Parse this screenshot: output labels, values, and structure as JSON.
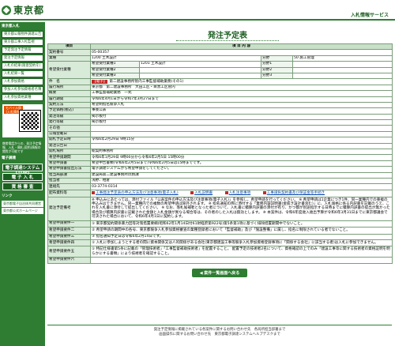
{
  "header": {
    "logo": "東京都",
    "service_title": "入札情報サービス"
  },
  "sidebar": {
    "section1": "東京都入札",
    "items": [
      "東京都公報物件調達公告",
      "東京都工事入札監視",
      "予定発注予定情報",
      "発注予定情報",
      "入札の結果(随意契約を)",
      "入札結果一覧",
      "入札参加資格",
      "参加入札参加資格者名簿",
      "入札参加資格業種"
    ],
    "mobile_label": "モバイル版(入札情報)",
    "mobile_note": "携帯電話からの、発注予定情報、入札・開札(契約)情報の閲覧が可能です",
    "section2": "電子調達",
    "buttons": [
      "電子調達システム(TOP)",
      "電 子 入 札",
      "資 格 審 査"
    ],
    "section3": "リンク",
    "links": [
      "東京都電子自治体共同運営",
      "東京都公式ホームページ"
    ]
  },
  "page": {
    "title": "発注予定表",
    "col_item": "項目",
    "col_content": "項 目 内 容"
  },
  "detail": {
    "contract_no_label": "契約番号",
    "contract_no": "05-00357",
    "industry_label": "業種",
    "industry": "1200 土木設計",
    "class_label": "分野",
    "class": "50 施工管理",
    "desired_label": "希望受付業種",
    "desired_rows": [
      {
        "label": "希望受付業種1",
        "value": "1201 土木設計",
        "sub": "分野1",
        "subval": ""
      },
      {
        "label": "希望受付業種2",
        "value": "",
        "sub": "分野2",
        "subval": ""
      },
      {
        "label": "希望受付業種3",
        "value": "",
        "sub": "分野3",
        "subval": ""
      }
    ],
    "name_label": "件　名",
    "name_tag": "【電子】",
    "name": "第二建設事務所管内工事監督補助業務(その1)",
    "location_label": "履行場所",
    "location": "東京都　第二建設事務所　大田工区・目黒工区管内",
    "summary_label": "概要",
    "summary": "工事監督補助業務　一式",
    "period_label": "履行期間",
    "period": "令和6年4月1日から令和7年3月27日まで",
    "method_label": "契約方法",
    "method": "希望制指名競争入札",
    "estimate_label": "予定価格(税込)",
    "estimate": "事後公表",
    "ordering_label": "発注等級",
    "ordering": "掲示板付",
    "cancel_label": "発行等級",
    "cancel": "掲示板付",
    "other_label": "その他",
    "other": "",
    "release_label": "公報登載日",
    "release": "",
    "open_label": "開札予定日時",
    "open": "令和6年2月29日 9時15分",
    "notice_label": "発注公告日",
    "notice": "",
    "venue_label": "開札場所",
    "venue": "総契約事務所",
    "accept_label": "希望申請期間",
    "accept": "令和6年1月29日 9時00分から令和6年2月5日 15時00分",
    "doc_label": "希望申請書",
    "doc": "希望申告書類(令和6年2月5日まで)令和6年2月5日は15時までです。",
    "docmethod_label": "希望申請書提出方法",
    "docmethod": "電子調達システムから希望申請をしてください。",
    "contact_label": "担当局部課",
    "contact": "建設局第二建設事務所庶務課",
    "person_label": "担当者",
    "person": "浅野、相倉",
    "tel_label": "連絡先",
    "tel": "03-3774-0314",
    "files_label": "配布資料等",
    "files": [
      "工事発注予定表の申込方法及び注意事項(電子入札)",
      "入札説明書",
      "入札注意事項",
      "工事請負契約書及び保証金等手続き"
    ],
    "notes_label": "発注予定備考",
    "notes": "※ 申込みにあたっては、添付ファイル「公表案件の申込方法及び注意事項(電子入札)」を参照し、希望申請を行ってください。\n※ 希望申請は1企業につき1件、同一業種内での重複の申込みはできません。同一業種内での複数の希望申請は除外されます。\n※ 指名通知の際に添付する「業務内容説明書(金抜き設計書含む)」に、入札価格に係る内訳書を記載のうえ、これを入札書に添付して提出してください。\n※ なお、落札候補者となった者について、入札書に積算内訳書の添付が有り、かつ都が別途指示する日時までに積算内訳書の提出が無かった場合及び積算内訳書に記載された金額と入札金額が異なる場合等は、その者のした入札は無効とします。\n※ 本案件は、令和6年度歳入歳出予算が令和6年3月31日までに東京都議会で可決された場合において、令和6年4月1日に契約します。",
    "cond_rows": [
      {
        "label": "希望申請要件一",
        "value": "① 東京都契約関係暴力団等対策措置要綱(昭和62年1月14日付61財経庶第922号)第5条第1項に基づく排除措置期間中でないこと。"
      },
      {
        "label": "希望申請要件二",
        "value": "② 希望申請の期間中の各号、東京都競争入札参加資格審査の業種登録者において「監督補助」及び「施設整備」に属し、指名に制限されている者でないこと。"
      },
      {
        "label": "希望申請要件三",
        "value": "③ 指名通知予定日は令和6年2月14日です。"
      },
      {
        "label": "希望申請要件四",
        "value": "① 入札に参加しようとする者の間に資本関係又は人的関係がある会社(東京都建設工事等競争入札参加資格登録事項に「関係する会社」に該当する者)は入札に参加できません。"
      },
      {
        "label": "希望申請要件五",
        "value": "① 特記仕様書第5条に記載の「管理技術者」「工事監督補助技術者」を配置すること。\n配置予定の技術者2名について、資格確認の上でのみ「建設工事等に関する技術者の資格証明を明らかにする書類」により技術者を確認すること。"
      },
      {
        "label": "希望申請要件六",
        "value": ""
      }
    ],
    "back_label": "◀ 案件一覧画面へ戻る"
  },
  "footer": {
    "line1": "発注予定情報に掲載されている各案件に関するお問い合わせ先　各局所担当部署まで",
    "line2": "画面操作に関するお問い合わせ先　東京都電子調達システムヘルプデスクまで"
  }
}
